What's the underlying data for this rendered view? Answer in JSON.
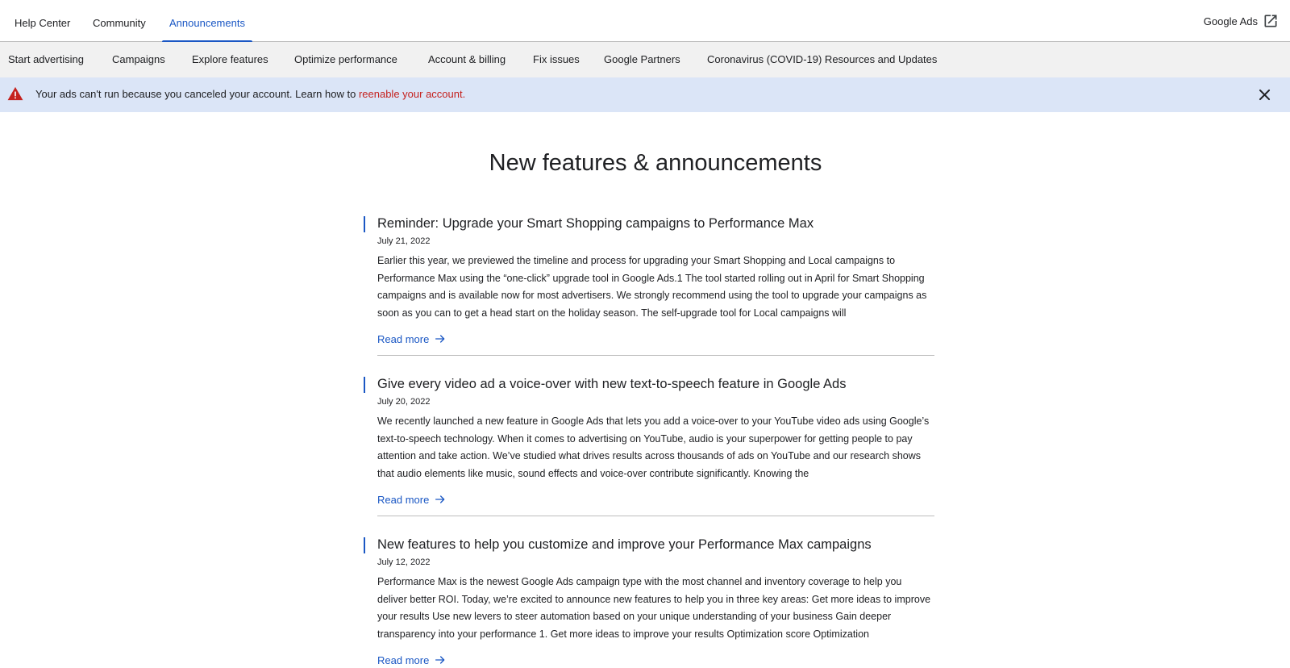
{
  "topnav": {
    "tabs": [
      {
        "label": "Help Center"
      },
      {
        "label": "Community"
      },
      {
        "label": "Announcements",
        "active": true
      }
    ],
    "brand": {
      "label": "Google Ads",
      "icon": "open-in-new-icon"
    }
  },
  "subnav": {
    "items": [
      {
        "label": "Start advertising"
      },
      {
        "label": "Campaigns"
      },
      {
        "label": "Explore features"
      },
      {
        "label": "Optimize performance"
      },
      {
        "label": "Account & billing"
      },
      {
        "label": "Fix issues"
      },
      {
        "label": "Google Partners"
      },
      {
        "label": "Coronavirus (COVID-19) Resources and Updates"
      }
    ]
  },
  "banner": {
    "icon": "warning-icon",
    "message": "Your ads can't run because you canceled your account. Learn how to",
    "link": "reenable your account.",
    "close_icon": "close-icon",
    "colors": {
      "background": "#dbe5f7",
      "link": "#c5221f",
      "warning": "#c5221f"
    }
  },
  "page": {
    "title": "New features & announcements"
  },
  "articles": [
    {
      "title": "Reminder: Upgrade your Smart Shopping campaigns to Performance Max",
      "date": "July 21, 2022",
      "excerpt": "Earlier this year, we previewed the timeline and process for upgrading your Smart Shopping and Local campaigns to Performance Max using the “one-click” upgrade tool in Google Ads.1 The tool started rolling out in April for Smart Shopping campaigns and is available now for most advertisers. We strongly recommend using the tool to upgrade your campaigns as soon as you can to get a head start on the holiday season. The self-upgrade tool for Local campaigns will",
      "read_more": "Read more"
    },
    {
      "title": "Give every video ad a voice-over with new text-to-speech feature in Google Ads",
      "date": "July 20, 2022",
      "excerpt": "We recently launched a new feature in Google Ads that lets you add a voice-over to your YouTube video ads using Google’s text-to-speech technology. When it comes to advertising on YouTube, audio is your superpower for getting people to pay attention and take action. We’ve studied what drives results across thousands of ads on YouTube and our research shows that audio elements like music, sound effects and voice-over contribute significantly. Knowing the",
      "read_more": "Read more"
    },
    {
      "title": "New features to help you customize and improve your Performance Max campaigns",
      "date": "July 12, 2022",
      "excerpt": "Performance Max is the newest Google Ads campaign type with the most channel and inventory coverage to help you deliver better ROI. Today, we’re excited to announce new features to help you in three key areas: Get more ideas to improve your results Use new levers to steer automation based on your unique understanding of your business Gain deeper transparency into your performance 1. Get more ideas to improve your results Optimization score Optimization",
      "read_more": "Read more"
    }
  ],
  "colors": {
    "accent": "#1a57c4",
    "subnav_bg": "#f1f1f1",
    "divider": "#bdbdbd"
  }
}
